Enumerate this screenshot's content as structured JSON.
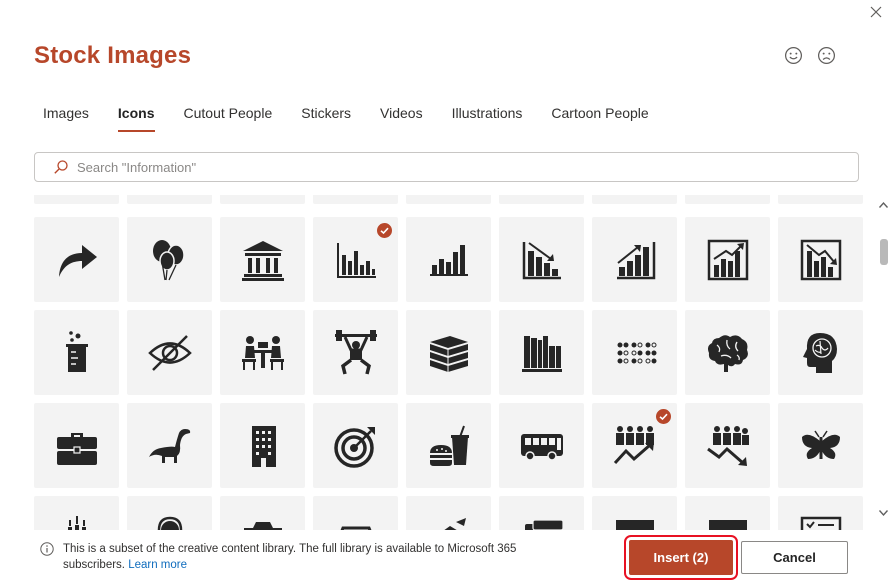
{
  "dialog": {
    "title": "Stock Images"
  },
  "tabs": [
    {
      "label": "Images",
      "active": false
    },
    {
      "label": "Icons",
      "active": true
    },
    {
      "label": "Cutout People",
      "active": false
    },
    {
      "label": "Stickers",
      "active": false
    },
    {
      "label": "Videos",
      "active": false
    },
    {
      "label": "Illustrations",
      "active": false
    },
    {
      "label": "Cartoon People",
      "active": false
    }
  ],
  "search": {
    "placeholder": "Search \"Information\"",
    "value": ""
  },
  "icons": {
    "row1": [
      {
        "name": "curved-arrow-icon",
        "selected": false
      },
      {
        "name": "balloons-icon",
        "selected": false
      },
      {
        "name": "bank-building-icon",
        "selected": false
      },
      {
        "name": "bar-chart-icon",
        "selected": true
      },
      {
        "name": "bar-chart-ascending-icon",
        "selected": false
      },
      {
        "name": "bar-chart-downward-trend-icon",
        "selected": false
      },
      {
        "name": "bar-chart-upward-trend-icon",
        "selected": false
      },
      {
        "name": "bar-chart-upward-trend-framed-icon",
        "selected": false
      },
      {
        "name": "bar-chart-downward-trend-framed-icon",
        "selected": false
      }
    ],
    "row2": [
      {
        "name": "beaker-icon",
        "selected": false
      },
      {
        "name": "eye-hidden-icon",
        "selected": false
      },
      {
        "name": "board-meeting-icon",
        "selected": false
      },
      {
        "name": "weightlifter-icon",
        "selected": false
      },
      {
        "name": "books-stack-icon",
        "selected": false
      },
      {
        "name": "books-on-shelf-icon",
        "selected": false
      },
      {
        "name": "braille-icon",
        "selected": false
      },
      {
        "name": "brain-icon",
        "selected": false
      },
      {
        "name": "head-with-brain-icon",
        "selected": false
      }
    ],
    "row3": [
      {
        "name": "briefcase-icon",
        "selected": false
      },
      {
        "name": "dinosaur-icon",
        "selected": false
      },
      {
        "name": "office-building-icon",
        "selected": false
      },
      {
        "name": "bullseye-target-icon",
        "selected": false
      },
      {
        "name": "fast-food-icon",
        "selected": false
      },
      {
        "name": "bus-icon",
        "selected": false
      },
      {
        "name": "business-growth-icon",
        "selected": true
      },
      {
        "name": "business-decline-icon",
        "selected": false
      },
      {
        "name": "butterfly-icon",
        "selected": false
      }
    ],
    "row4": [
      {
        "name": "candles-icon"
      },
      {
        "name": "person-with-headset-icon"
      },
      {
        "name": "camera-icon"
      },
      {
        "name": "car-icon"
      },
      {
        "name": "carrot-icon"
      },
      {
        "name": "cards-icon"
      },
      {
        "name": "box-icon"
      },
      {
        "name": "box-icon"
      },
      {
        "name": "checklist-icon"
      }
    ]
  },
  "footer": {
    "info_text": "This is a subset of the creative content library. The full library is available to Microsoft 365 subscribers.",
    "learn_more": "Learn more",
    "insert_label": "Insert (2)",
    "cancel_label": "Cancel"
  },
  "colors": {
    "accent": "#b7472a",
    "highlight": "#e81123",
    "link": "#0f6cbd",
    "tile": "#f3f3f3"
  }
}
